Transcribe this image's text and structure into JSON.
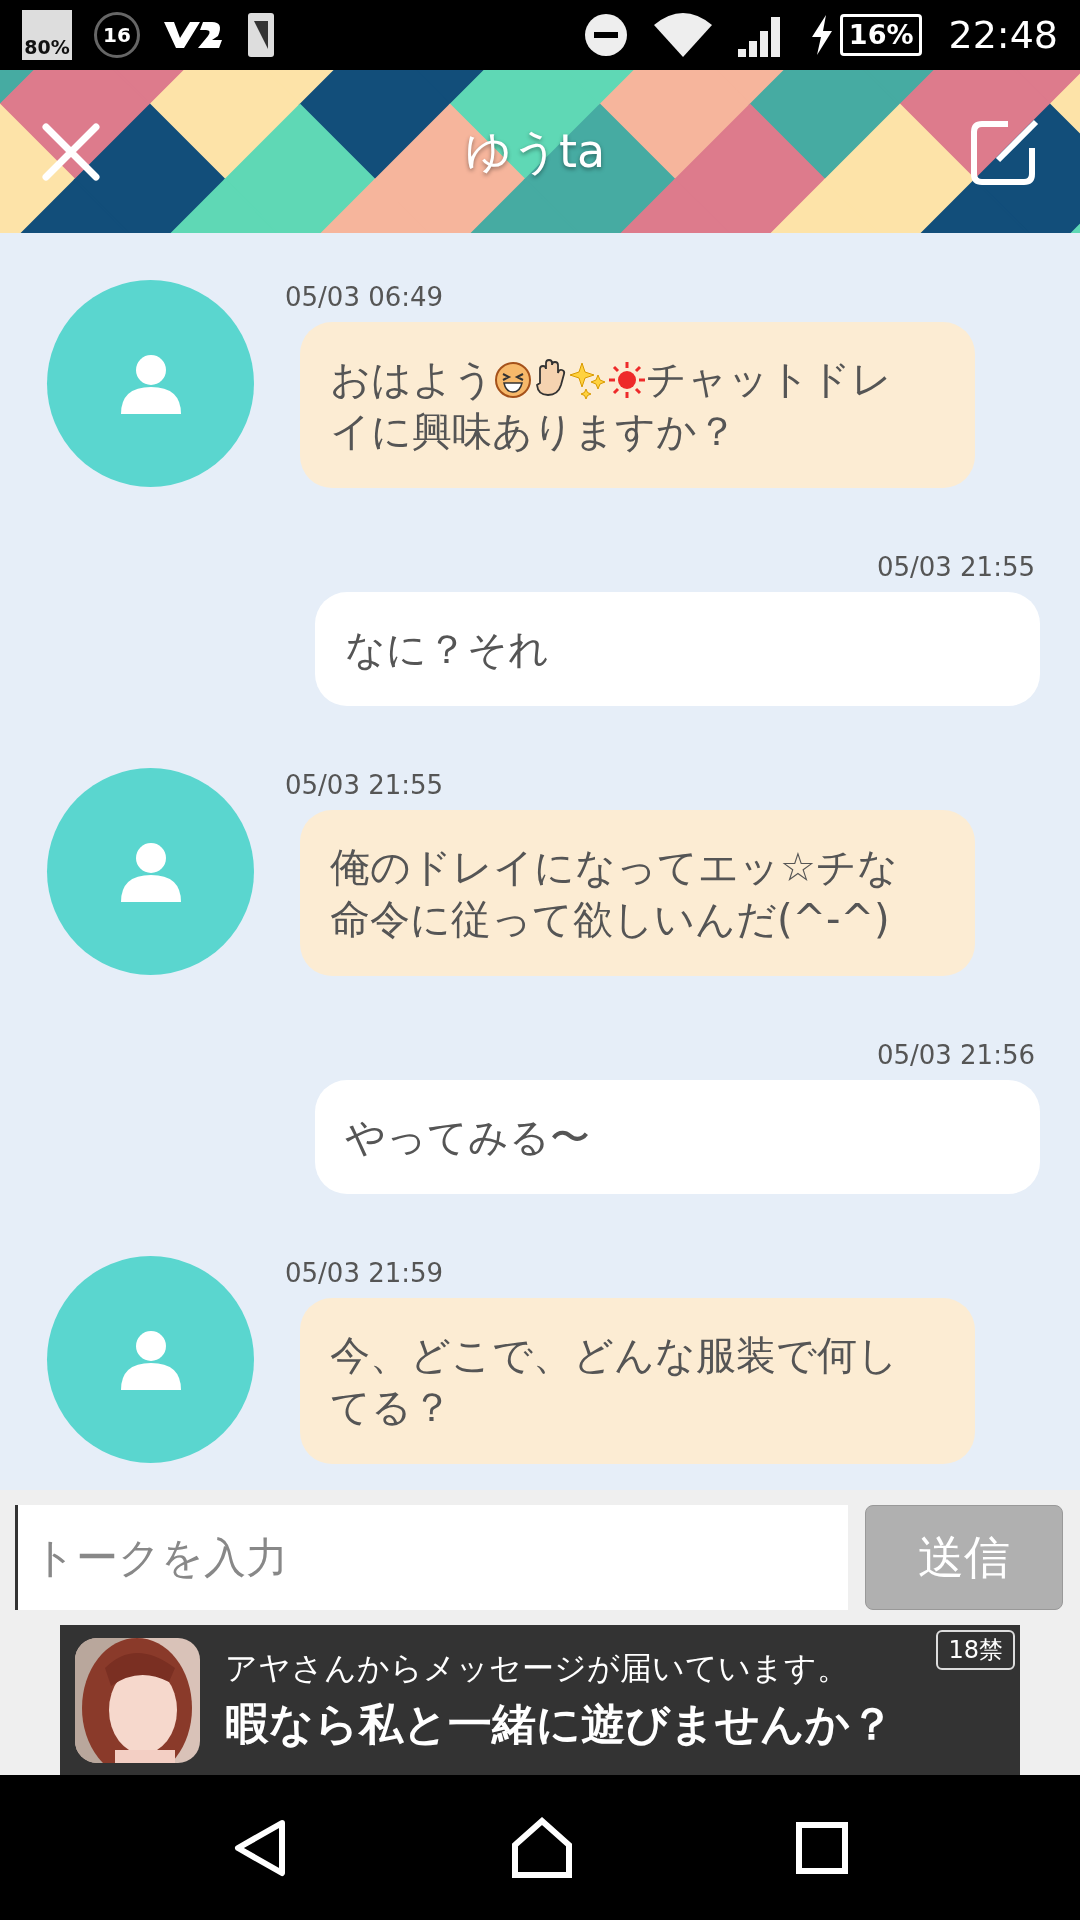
{
  "status_bar": {
    "indicators": [
      "80%",
      "16"
    ],
    "battery": "16%",
    "time": "22:48"
  },
  "header": {
    "title": "ゆうta"
  },
  "messages": [
    {
      "kind": "incoming",
      "time": "05/03 06:49",
      "segments": [
        {
          "kind": "text",
          "text": "おはよう"
        },
        {
          "kind": "grin"
        },
        {
          "kind": "hand"
        },
        {
          "kind": "sparkles"
        },
        {
          "kind": "sun"
        },
        {
          "kind": "text",
          "text": "チャットドレ"
        },
        {
          "kind": "break"
        },
        {
          "kind": "text",
          "text": "イに興味ありますか？"
        }
      ]
    },
    {
      "kind": "outgoing",
      "time": "05/03 21:55",
      "segments": [
        {
          "kind": "text",
          "text": "なに？それ"
        }
      ]
    },
    {
      "kind": "incoming",
      "time": "05/03 21:55",
      "segments": [
        {
          "kind": "text",
          "text": "俺のドレイになってエッ☆チな命令に従って欲しいんだ(^-^)"
        }
      ]
    },
    {
      "kind": "outgoing",
      "time": "05/03 21:56",
      "segments": [
        {
          "kind": "text",
          "text": "やってみる〜"
        }
      ]
    },
    {
      "kind": "incoming",
      "time": "05/03 21:59",
      "segments": [
        {
          "kind": "text",
          "text": "今、どこで、どんな服装で何してる？"
        }
      ]
    }
  ],
  "composer": {
    "placeholder": "トークを入力",
    "send_label": "送信"
  },
  "ad": {
    "line1": "アヤさんからメッセージが届いています。",
    "line2": "暇なら私と一緒に遊びませんか？",
    "badge": "18禁"
  }
}
